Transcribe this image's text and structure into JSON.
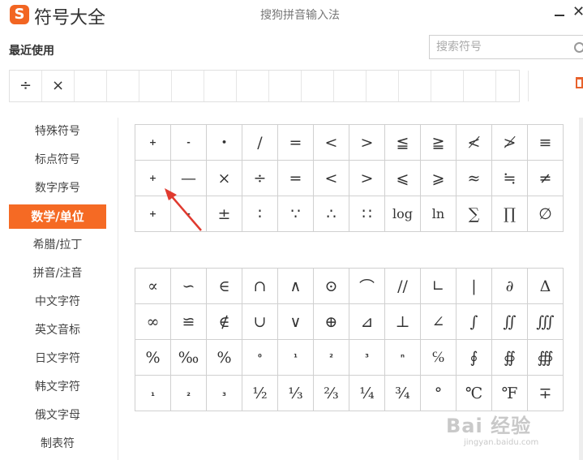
{
  "app": {
    "title": "符号大全",
    "window_title": "搜狗拼音输入法",
    "logo_glyph": "S",
    "accent": "#f56a24"
  },
  "recent": {
    "title": "最近使用",
    "items": [
      "÷",
      "×",
      "",
      "",
      "",
      "",
      "",
      "",
      "",
      "",
      "",
      "",
      "",
      "",
      "",
      ""
    ]
  },
  "search": {
    "placeholder": "搜索符号"
  },
  "sidebar": {
    "items": [
      "特殊符号",
      "标点符号",
      "数字序号",
      "数学/单位",
      "希腊/拉丁",
      "拼音/注音",
      "中文字符",
      "英文音标",
      "日文字符",
      "韩文字符",
      "俄文字母",
      "制表符"
    ],
    "active": "数学/单位"
  },
  "group1": [
    "+",
    "-",
    "•",
    "/",
    "=",
    "<",
    ">",
    "≦",
    "≧",
    "≮",
    "≯",
    "≡",
    "+",
    "—",
    "×",
    "÷",
    "=",
    "<",
    ">",
    "⩽",
    "⩾",
    "≈",
    "≒",
    "≠",
    "+",
    "-",
    "±",
    "∶",
    "∵",
    "∴",
    "∷",
    "log",
    "ln",
    "∑",
    "∏",
    "∅"
  ],
  "group2": [
    "∝",
    "∽",
    "∈",
    "∩",
    "∧",
    "⊙",
    "⌒",
    "//",
    "∟",
    "|",
    "∂",
    "Δ",
    "∞",
    "≌",
    "∉",
    "∪",
    "∨",
    "⊕",
    "⊿",
    "⊥",
    "∠",
    "∫",
    "∬",
    "∭",
    "%",
    "‰",
    "%",
    "⁰",
    "¹",
    "²",
    "³",
    "ⁿ",
    "℅",
    "∮",
    "∯",
    "∰",
    "₁",
    "₂",
    "₃",
    "½",
    "⅓",
    "⅔",
    "¼",
    "¾",
    "°",
    "℃",
    "℉",
    "∓"
  ],
  "watermark": {
    "main": "Bai 经验",
    "sub": "jingyan.baidu.com"
  },
  "annotation": {
    "arrow_color": "#e03a2f"
  }
}
